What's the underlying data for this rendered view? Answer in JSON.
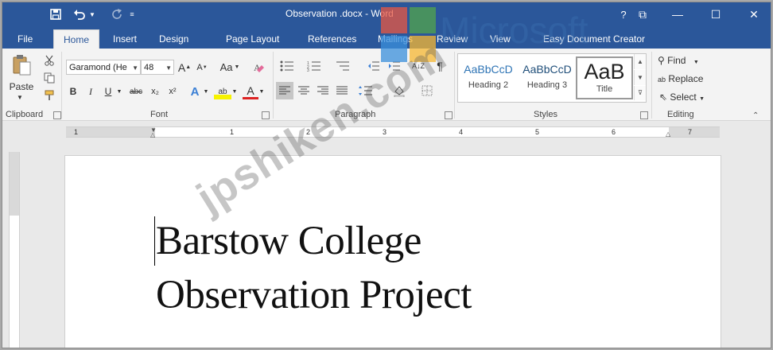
{
  "window": {
    "document_name": "Observation .docx",
    "separator": "-",
    "app_name": "Word",
    "help_label": "?",
    "controls": {
      "ribbon_display": "⧉",
      "minimize": "—",
      "maximize": "☐",
      "close": "✕"
    }
  },
  "qat": {
    "save_icon": "save-icon",
    "undo_icon": "undo-icon",
    "redo_icon": "redo-icon"
  },
  "tabs": [
    {
      "label": "File"
    },
    {
      "label": "Home",
      "active": true
    },
    {
      "label": "Insert"
    },
    {
      "label": "Design"
    },
    {
      "label": "Page Layout"
    },
    {
      "label": "References"
    },
    {
      "label": "Mailings"
    },
    {
      "label": "Review"
    },
    {
      "label": "View"
    },
    {
      "label": "Easy Document Creator"
    }
  ],
  "ribbon": {
    "clipboard": {
      "paste_label": "Paste",
      "group_label": "Clipboard"
    },
    "font": {
      "font_name": "Garamond (He",
      "font_size": "48",
      "grow": "A",
      "shrink": "A",
      "change_case": "Aa",
      "bold": "B",
      "italic": "I",
      "underline": "U",
      "strike": "abc",
      "subscript": "x₂",
      "superscript": "x²",
      "text_effects": "A",
      "highlight": "ab",
      "font_color": "A",
      "group_label": "Font"
    },
    "paragraph": {
      "sort": "A↓Z",
      "show_marks": "¶",
      "group_label": "Paragraph"
    },
    "styles": {
      "items": [
        {
          "sample": "AaBbCcD",
          "name": "Heading 2"
        },
        {
          "sample": "AaBbCcD",
          "name": "Heading 3"
        },
        {
          "sample": "AaB",
          "name": "Title"
        }
      ],
      "group_label": "Styles"
    },
    "editing": {
      "find": "Find",
      "replace": "Replace",
      "select": "Select",
      "group_label": "Editing"
    }
  },
  "ruler": {
    "numbers": [
      "1",
      "1",
      "2",
      "3",
      "4",
      "5",
      "6",
      "7"
    ]
  },
  "document": {
    "lines": [
      "Barstow College",
      "Observation Project"
    ]
  },
  "overlay": {
    "brand_text": "Microsoft",
    "watermark_text": "jpshiken.com",
    "logo_colors": {
      "red": "#e85742",
      "green": "#52a54c",
      "blue": "#3a8fdc",
      "yellow": "#f6b832"
    }
  },
  "colors": {
    "title_bar": "#2b579a",
    "ribbon": "#f3f3f3"
  }
}
